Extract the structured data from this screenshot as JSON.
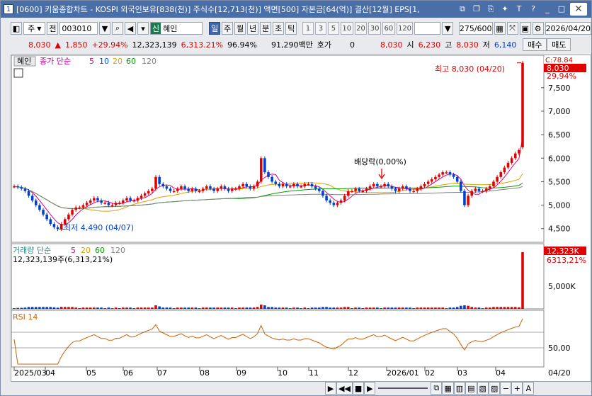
{
  "titlebar": {
    "number": "1",
    "title": "[0600] 키움종합차트 - KOSPI 외국인보유[838(천)] 주식수[12,713(천)] 액면[500] 자본금[64(억)] 결산[12월] EPS[1,"
  },
  "toolbar": {
    "type_select": "주",
    "prev_label": "전",
    "code": "003010",
    "name_badge": "신",
    "name": "혜인",
    "periods": [
      "일",
      "주",
      "월",
      "년",
      "분",
      "초",
      "틱"
    ],
    "active_period": "일",
    "intervals": [
      "1",
      "3",
      "5",
      "10",
      "20",
      "30",
      "60",
      "120"
    ],
    "count": "275/600",
    "date": "2026/04/20"
  },
  "quote": {
    "price": "8,030",
    "arrow": "▲",
    "change": "1,850",
    "change_pct": "+29.94%",
    "volume": "12,323,139",
    "vol_ratio": "6,313.21%",
    "strength": "96.94%",
    "amount": "91,290백만",
    "quote_label": "호가",
    "quote_value": "0",
    "ask": "8,030",
    "open_label": "시",
    "open": "6,230",
    "high_label": "고",
    "high": "8,030",
    "low_label": "저",
    "low": "6,140",
    "buy": "매수",
    "sell": "매도"
  },
  "price_panel": {
    "name": "혜인",
    "legend_prefix": "종가 단순",
    "ma_periods": [
      "5",
      "10",
      "20",
      "60",
      "120"
    ],
    "ma_colors": [
      "#e0007f",
      "#0050e0",
      "#e0a000",
      "#00a000",
      "#808080"
    ],
    "y_ticks": [
      "7,500",
      "7,000",
      "6,500",
      "6,000",
      "5,500",
      "5,000",
      "4,500"
    ],
    "high_note": "최고 8,030 (04/20)",
    "low_note": "최저 4,490 (04/07)",
    "dividend_note": "배당락(0,00%)",
    "right_tag_price": "8,030",
    "right_tag_pct": "29,94%",
    "right_tag_top": "C:78.84"
  },
  "volume_panel": {
    "legend_prefix": "거래량 단순",
    "ma_periods": [
      "5",
      "20",
      "60",
      "120"
    ],
    "vol_text": "12,323,139주(6,313,21%)",
    "y_tick": "5,000K",
    "right_tag": "12,323K",
    "right_tag_pct": "6313,21%"
  },
  "rsi_panel": {
    "label": "RSI 14",
    "y_tick": "50,00"
  },
  "x_axis": {
    "labels": [
      "2025/03",
      "04",
      "05",
      "06",
      "07",
      "08",
      "09",
      "10",
      "11",
      "12",
      "2026/01",
      "02",
      "03",
      "04"
    ],
    "right_label": "04/20"
  },
  "colors": {
    "up": "#e00000",
    "down": "#0040d0",
    "rsi": "#d06000"
  },
  "chart_data": {
    "type": "line",
    "series": [
      {
        "name": "종가",
        "values": [
          5400,
          5380,
          5350,
          5300,
          5200,
          5100,
          5000,
          4900,
          4800,
          4700,
          4600,
          4530,
          4490,
          4600,
          4700,
          4800,
          4900,
          4950,
          4950,
          5000,
          5050,
          5100,
          5150,
          5100,
          5050,
          5050,
          5000,
          5000,
          5050,
          5050,
          5100,
          5150,
          5100,
          5100,
          5150,
          5200,
          5250,
          5300,
          5350,
          5600,
          5450,
          5400,
          5350,
          5300,
          5300,
          5350,
          5400,
          5350,
          5300,
          5350,
          5300,
          5300,
          5350,
          5400,
          5350,
          5300,
          5350,
          5400,
          5350,
          5300,
          5350,
          5350,
          5400,
          5450,
          5400,
          5350,
          5400,
          5500,
          6000,
          5700,
          5600,
          5500,
          5450,
          5400,
          5450,
          5400,
          5400,
          5450,
          5400,
          5400,
          5450,
          5450,
          5400,
          5350,
          5300,
          5200,
          5100,
          5050,
          5000,
          5050,
          5100,
          5200,
          5300,
          5300,
          5350,
          5300,
          5300,
          5350,
          5400,
          5450,
          5400,
          5400,
          5450,
          5400,
          5350,
          5300,
          5350,
          5400,
          5350,
          5300,
          5300,
          5350,
          5400,
          5450,
          5500,
          5550,
          5600,
          5650,
          5700,
          5700,
          5650,
          5600,
          5500,
          5300,
          5000,
          5200,
          5300,
          5350,
          5300,
          5300,
          5350,
          5400,
          5500,
          5600,
          5700,
          5800,
          5900,
          6000,
          6100,
          6170,
          8030
        ]
      }
    ]
  }
}
